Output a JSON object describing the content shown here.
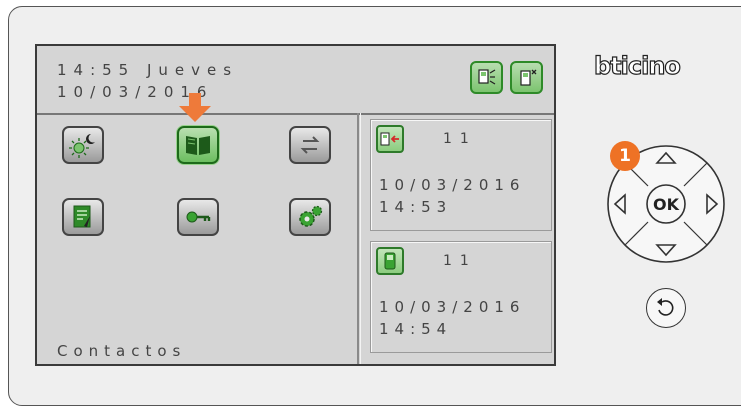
{
  "screen": {
    "time_day": "14:55 Jueves",
    "date": "10/03/2016",
    "footer_label": "Contactos",
    "header_icons": [
      "intercom-config-icon",
      "intercom-device-config-icon"
    ],
    "menu_icons": [
      "day-night-icon",
      "contacts-book-icon",
      "transfer-arrows-icon",
      "document-icon",
      "key-icon",
      "settings-gears-icon"
    ],
    "selected_menu_item": "contacts-book-icon"
  },
  "events": [
    {
      "icon": "missed-call-icon",
      "number": "11",
      "date": "10/03/2016",
      "time": "14:53"
    },
    {
      "icon": "intercom-unit-icon",
      "number": "11",
      "date": "10/03/2016",
      "time": "14:54"
    }
  ],
  "device": {
    "brand": "bticino",
    "callout_number": "1",
    "ok_label": "OK"
  },
  "colors": {
    "accent_green": "#2e8a28",
    "callout_orange": "#ee7225",
    "screen_background": "#d5d5d5"
  }
}
